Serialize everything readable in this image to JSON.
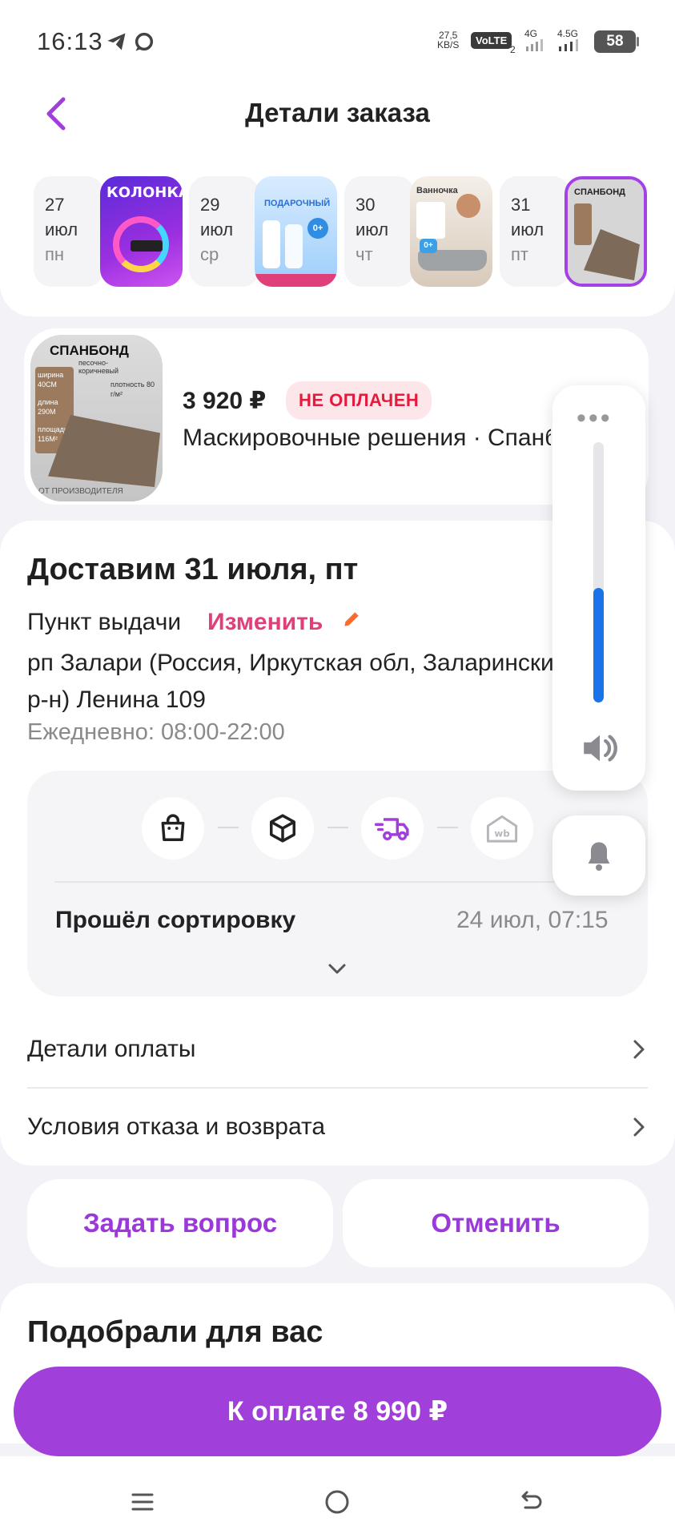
{
  "status_bar": {
    "time": "16:13",
    "net_speed_value": "27,5",
    "net_speed_unit": "KB/S",
    "volte": "VoLTE",
    "volte_sub": "2",
    "sig1": "4G",
    "sig2": "4.5G",
    "battery": "58"
  },
  "header": {
    "title": "Детали заказа"
  },
  "timeline": [
    {
      "num": "27",
      "month": "июл",
      "weekday": "пн"
    },
    {
      "num": "29",
      "month": "июл",
      "weekday": "ср"
    },
    {
      "num": "30",
      "month": "июл",
      "weekday": "чт"
    },
    {
      "num": "31",
      "month": "июл",
      "weekday": "пт"
    }
  ],
  "thumbnails": {
    "t1_brand": "КОЛОНКА",
    "t2_brand": "ПОДАРОЧНЫЙ",
    "t2_badge": "0+",
    "t3_title": "Ванночка",
    "t3_badge": "0+",
    "t4_brand": "СПАНБОНД"
  },
  "product": {
    "img_title": "СПАНБОНД",
    "img_sub": "песочно-коричневый",
    "img_w": "ширина 40СМ",
    "img_l": "длина 290М",
    "img_a": "площадь 116М²",
    "img_d": "плотность 80 г/м²",
    "img_footer": "от производителя",
    "price": "3 920 ₽",
    "status": "НЕ ОПЛАЧЕН",
    "name": "Маскировочные решения · Спанбонд"
  },
  "delivery": {
    "title": "Доставим 31 июля, пт",
    "pickup_label": "Пункт выдачи",
    "change": "Изменить",
    "address": "рп Залари (Россия, Иркутская обл, Заларинский р-н) Ленина 109",
    "hours": "Ежедневно: 08:00-22:00",
    "status": "Прошёл сортировку",
    "status_time": "24 июл, 07:15",
    "wb_label": "wb"
  },
  "rows": {
    "payment_details": "Детали оплаты",
    "return_terms": "Условия отказа и возврата"
  },
  "actions": {
    "ask": "Задать вопрос",
    "cancel": "Отменить"
  },
  "recommendations": {
    "title": "Подобрали для вас"
  },
  "pay": {
    "label": "К оплате 8 990 ₽"
  },
  "volume": {
    "level_fraction": 0.44,
    "accent": "#1a73e8"
  },
  "colors": {
    "brand": "#a03fd9",
    "link_pink": "#e0407a",
    "unpaid_red": "#e31b3c"
  }
}
